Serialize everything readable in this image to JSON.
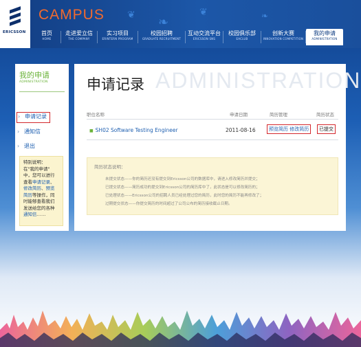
{
  "brand": {
    "logo_text": "ERICSSON",
    "site_name": "CAMPUS"
  },
  "nav": [
    {
      "cn": "首页",
      "en": "HOME"
    },
    {
      "cn": "走进爱立信",
      "en": "THE COMPANY"
    },
    {
      "cn": "实习项目",
      "en": "ERINTERN PROGRAM"
    },
    {
      "cn": "校园招聘",
      "en": "GRADUATE RECRUITMENT"
    },
    {
      "cn": "互动交流平台",
      "en": "ERICSSON SNS"
    },
    {
      "cn": "校园俱乐部",
      "en": "EACLUB"
    },
    {
      "cn": "创新大赛",
      "en": "INNOVATION COMPETITION"
    },
    {
      "cn": "我的申请",
      "en": "ADMINISTRATION"
    }
  ],
  "sidebar": {
    "title": "我的申请",
    "subtitle": "ADMINISTRATION",
    "items": [
      {
        "label": "申请记录"
      },
      {
        "label": "通知信"
      },
      {
        "label": "退出"
      }
    ],
    "note": {
      "heading": "特别说明：",
      "l1": "在\"我的申请\"",
      "l2": "中，您可以进行",
      "l3a": "查看",
      "l3b": "申请记录",
      "l3c": "、",
      "l4a": "修改简历",
      "l4b": "、",
      "l4c": "预览",
      "l5a": "简历",
      "l5b": "等操作，同",
      "l6": "时能够查看我们",
      "l7": "发送给您的各种",
      "l8a": "通知信",
      "l8b": "……"
    }
  },
  "main": {
    "watermark": "ADMINISTRATION",
    "title": "申请记录",
    "columns": {
      "job": "职位名称",
      "date": "申请日期",
      "mgmt": "简历管理",
      "status": "简历状态"
    },
    "rows": [
      {
        "job": "SH02 Software Testing Engineer",
        "date": "2011-08-16",
        "preview": "预览简历",
        "edit": "修改简历",
        "status": "已提交"
      }
    ],
    "explain": {
      "title": "简历状态说明：",
      "lines": [
        "未提交状态——你的简历还没有提交到Ericsson公司的数据库中，请进入修改简历并提交；",
        "已提交状态——简历成功的提交到Ericsson公司的简历库中了，此状态是可以修改简历的；",
        "已处理状态——Ericsson公司的招聘人员已经处理过您的简历，此时您的简历不能再修改了；",
        "过期提交状态——你提交简历的时间超过了公司公布的简历接收截止日期。"
      ]
    }
  },
  "colors": {
    "accent_orange": "#f06a2f",
    "accent_green": "#6bb33a",
    "link_blue": "#1e5fb0",
    "highlight_red": "#d3262b",
    "header_blue": "#1c57a8"
  }
}
